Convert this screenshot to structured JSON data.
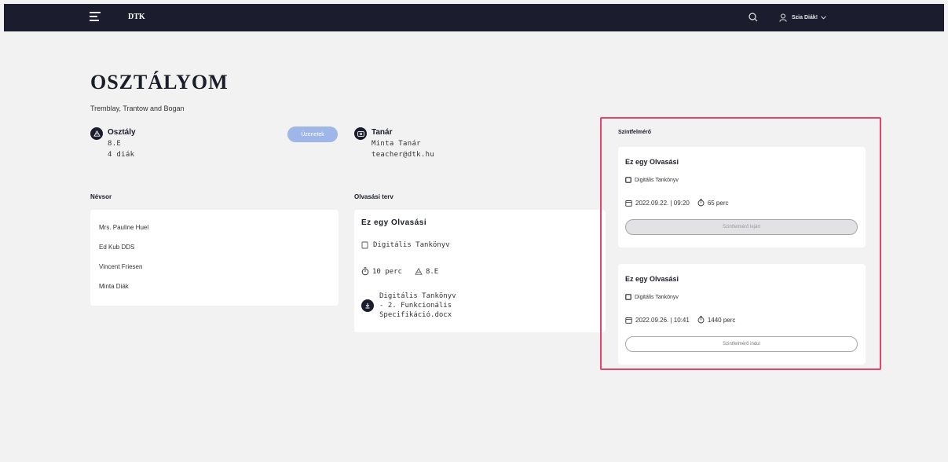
{
  "header": {
    "logo": "DTK",
    "user_name": "Szia Diák!"
  },
  "page": {
    "title": "OSZTÁLYOM",
    "subtitle": "Tremblay, Trantow and Bogan"
  },
  "class_info": {
    "heading": "Osztály",
    "name": "8.E",
    "students": "4 diák",
    "messages_button": "Üzenetek"
  },
  "teacher_info": {
    "heading": "Tanár",
    "name": "Minta Tanár",
    "email": "teacher@dtk.hu"
  },
  "roster": {
    "label": "Névsor",
    "students": [
      "Mrs. Pauline Huel",
      "Ed Kub DDS",
      "Vincent Friesen",
      "Minta Diák"
    ]
  },
  "reading_plan": {
    "label": "Olvasási terv",
    "title": "Ez egy Olvasási",
    "book": "Digitális Tankönyv",
    "duration": "10 perc",
    "class": "8.E",
    "file_line1": "Digitális Tankönyv",
    "file_line2": "- 2. Funkcionális",
    "file_line3": "Specifikáció.docx"
  },
  "level_assessment": {
    "label": "Szintfelmérő",
    "items": [
      {
        "title": "Ez egy Olvasási",
        "book": "Digitális Tankönyv",
        "datetime": "2022.09.22. | 09:20",
        "duration": "65 perc",
        "button": "Szintfelmérő lejárt",
        "state": "expired"
      },
      {
        "title": "Ez egy Olvasási",
        "book": "Digitális Tankönyv",
        "datetime": "2022.09.26. | 10:41",
        "duration": "1440 perc",
        "button": "Szintfelmérő indul",
        "state": "start"
      }
    ]
  },
  "colors": {
    "topbar": "#1b1d2e",
    "accent_button": "#9fb6e8",
    "highlight_frame": "#e8436a",
    "background": "#f2f2f2"
  }
}
